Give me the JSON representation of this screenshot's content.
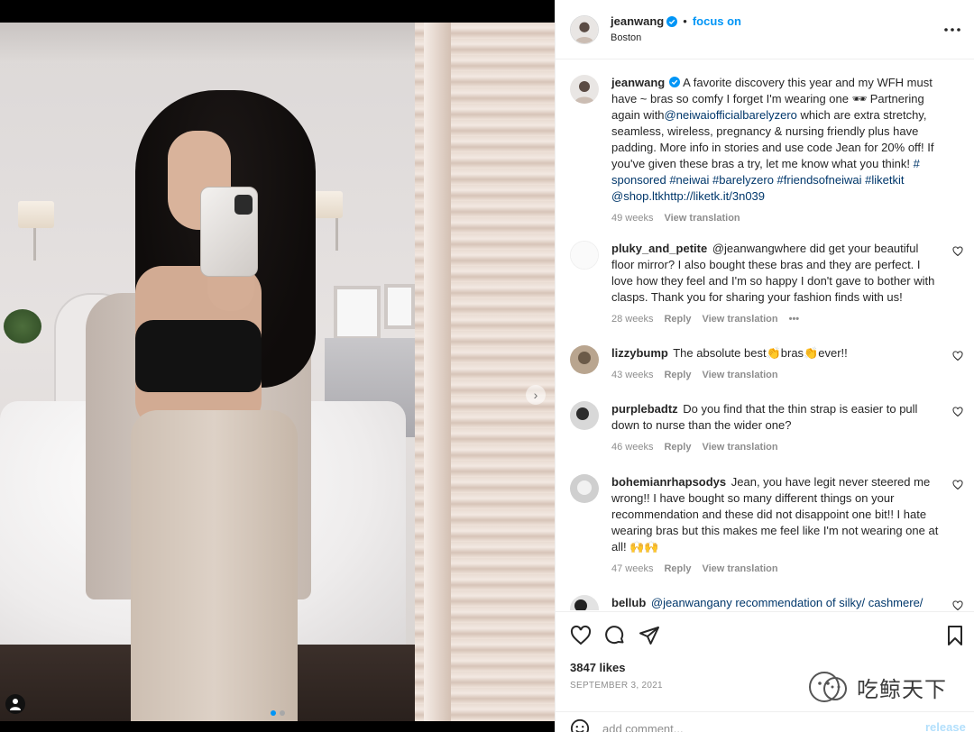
{
  "post": {
    "author": "jeanwang",
    "follow_label": "focus on",
    "header_separator": "•",
    "location": "Boston",
    "carousel_next": "›",
    "carousel_total": 2,
    "carousel_active": 1
  },
  "caption": {
    "username": "jeanwang",
    "text_before": "A favorite discovery this year and my WFH must have ~ bras so comfy I forget I'm wearing one 🕶 Partnering again with",
    "mention": "@neiwaiofficialbarelyzero",
    "text_middle": " which are extra stretchy, seamless, wireless, pregnancy & nursing friendly plus have padding. More info in stories and use code Jean for 20% off! If you've given these bras a try, let me know what you think! ",
    "hashtags": "# sponsored #neiwai #barelyzero #friendsofneiwai #liketkit",
    "link": "@shop.ltkhttp://liketk.it/3n039",
    "time": "49 weeks",
    "translate": "View translation"
  },
  "comments": [
    {
      "username": "pluky_and_petite",
      "text": "@jeanwangwhere did get your beautiful floor mirror? I also bought these bras and they are perfect. I love how they feel and I'm so happy I don't gave to bother with clasps. Thank you for sharing your fashion finds with us!",
      "time": "28 weeks",
      "reply": "Reply",
      "translate": "View translation",
      "more": "•••"
    },
    {
      "username": "lizzybump",
      "text": "The absolute best👏bras👏ever!!",
      "time": "43 weeks",
      "reply": "Reply",
      "translate": "View translation"
    },
    {
      "username": "purplebadtz",
      "text": "Do you find that the thin strap is easier to pull down to nurse than the wider one?",
      "time": "46 weeks",
      "reply": "Reply",
      "translate": "View translation"
    },
    {
      "username": "bohemianrhapsodys",
      "text": "Jean, you have legit never steered me wrong!! I have bought so many different things on your recommendation and these did not disappoint one bit!! I hate wearing bras but this makes me feel like I'm not wearing one at all! 🙌🙌",
      "time": "47 weeks",
      "reply": "Reply",
      "translate": "View translation"
    },
    {
      "username": "bellub",
      "text": "@jeanwangany recommendation of silky/ cashmere/"
    }
  ],
  "footer": {
    "likes": "3847 likes",
    "date": "SEPTEMBER 3, 2021",
    "comment_placeholder": "add comment...",
    "post_label": "release"
  },
  "watermark": {
    "text": "吃鲸天下"
  },
  "colors": {
    "link_blue": "#0095f6",
    "hashtag_blue": "#00376b",
    "muted": "#8e8e8e",
    "text": "#262626",
    "verified": "#0095f6"
  },
  "icons": {
    "heart": "heart-icon",
    "comment": "comment-icon",
    "share": "paper-plane-icon",
    "save": "bookmark-icon",
    "more": "more-dots-icon",
    "emoji": "emoji-icon",
    "verified": "verified-badge-icon",
    "tag": "person-tag-icon"
  }
}
